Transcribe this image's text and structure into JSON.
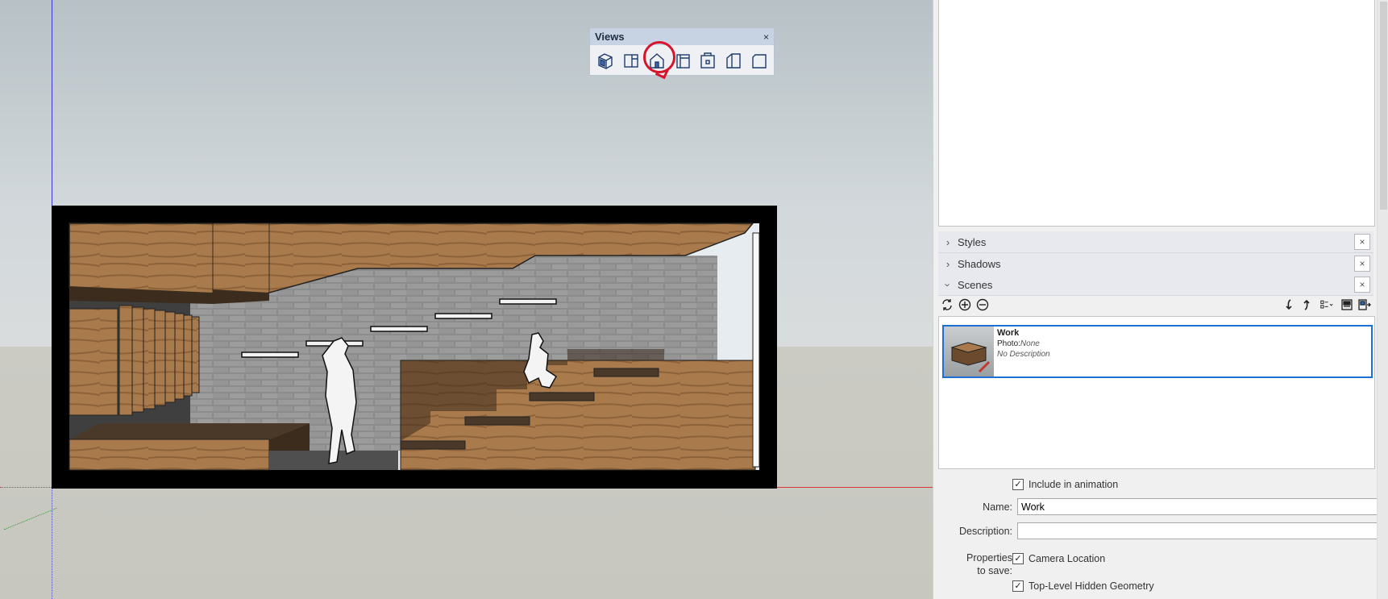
{
  "views_toolbar": {
    "title": "Views",
    "close": "×",
    "buttons": [
      "iso-view-icon",
      "top-view-icon",
      "front-view-icon",
      "right-view-icon",
      "back-view-icon",
      "left-view-icon",
      "bottom-view-icon"
    ],
    "highlighted": "front-view-icon",
    "highlight_color": "#d7142c"
  },
  "tray": {
    "panels": [
      {
        "label": "Styles",
        "expanded": false
      },
      {
        "label": "Shadows",
        "expanded": false
      },
      {
        "label": "Scenes",
        "expanded": true
      }
    ],
    "close_glyph": "×"
  },
  "scenes": {
    "toolbar_left": [
      "refresh-icon",
      "add-scene-icon",
      "remove-scene-icon"
    ],
    "toolbar_right": [
      "move-down-icon",
      "move-up-icon",
      "view-options-icon",
      "show-details-icon",
      "hide-details-icon"
    ],
    "items": [
      {
        "name": "Work",
        "photo_label": "Photo:",
        "photo_value": "None",
        "description": "No Description",
        "selected": true
      }
    ]
  },
  "properties": {
    "include_animation_label": "Include in animation",
    "include_animation_checked": true,
    "name_label": "Name:",
    "name_value": "Work",
    "description_label": "Description:",
    "description_value": "",
    "properties_label_1": "Properties",
    "properties_label_2": "to save:",
    "camera_location_label": "Camera Location",
    "camera_location_checked": true,
    "hidden_geometry_label": "Top-Level Hidden Geometry",
    "hidden_geometry_checked": true
  },
  "colors": {
    "selection_blue": "#1d6fd4",
    "axis_red": "#d23a3a",
    "axis_blue": "#3a3ad8",
    "axis_green": "#2a9a2a"
  }
}
